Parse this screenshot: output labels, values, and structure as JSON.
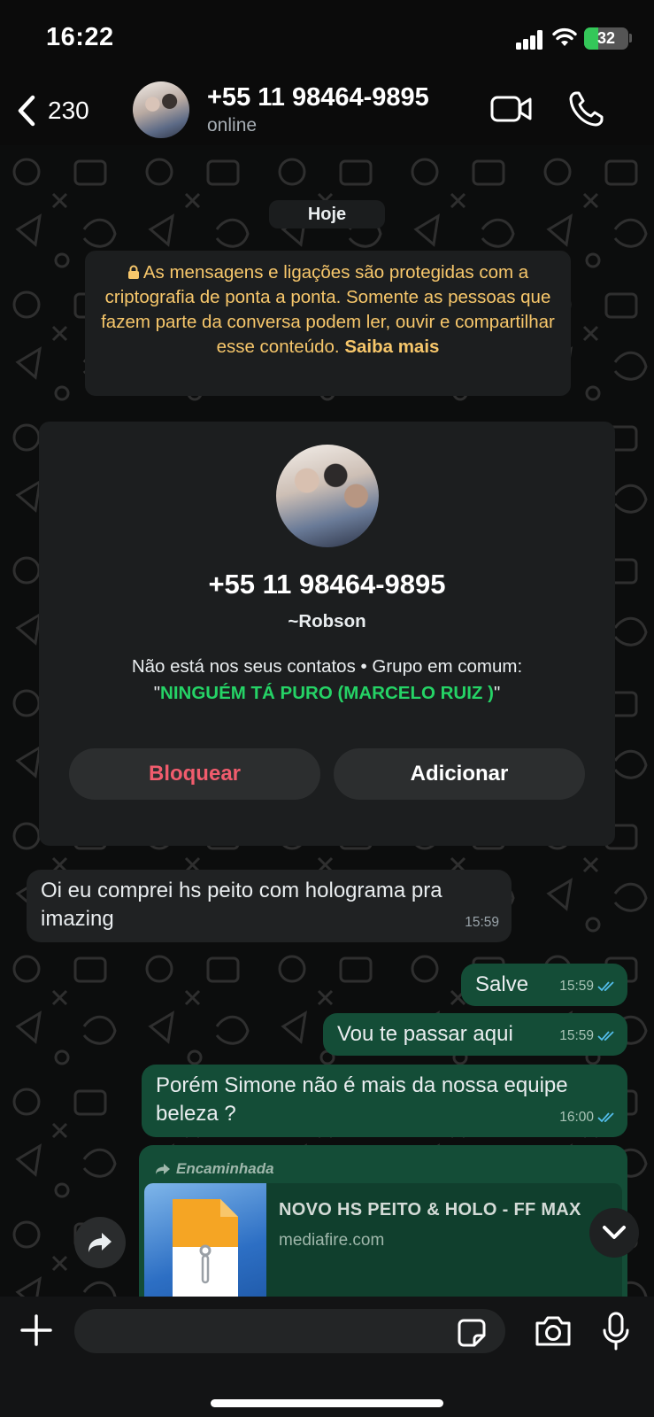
{
  "status_bar": {
    "time": "16:22",
    "battery": "32",
    "battery_level": 0.32
  },
  "header": {
    "back_count": "230",
    "contact_name": "+55 11 98464-9895",
    "contact_status": "online"
  },
  "chat": {
    "date_label": "Hoje",
    "encryption_notice": "As mensagens e ligações são protegidas com a criptografia de ponta a ponta. Somente as pessoas que fazem parte da conversa podem ler, ouvir e compartilhar esse conteúdo.",
    "encryption_link": "Saiba mais",
    "contact_card": {
      "phone": "+55 11 98464-9895",
      "push_name": "~Robson",
      "info_prefix": "Não está nos seus contatos • Grupo em comum:",
      "group_name": "NINGUÉM TÁ PURO (MARCELO RUIZ )",
      "block_label": "Bloquear",
      "add_label": "Adicionar"
    },
    "messages": [
      {
        "direction": "in",
        "text": "Oi eu comprei hs peito com holograma pra imazing",
        "time": "15:59"
      },
      {
        "direction": "out",
        "text": "Salve",
        "time": "15:59",
        "read": true
      },
      {
        "direction": "out",
        "text": "Vou te passar aqui",
        "time": "15:59",
        "read": true
      },
      {
        "direction": "out",
        "text": "Porém Simone não é mais da nossa equipe beleza ?",
        "time": "16:00",
        "read": true
      }
    ],
    "forwarded": {
      "label": "Encaminhada",
      "link_title": "NOVO HS PEITO & HOLO - FF MAX",
      "link_domain": "mediafire.com"
    }
  },
  "input_bar": {
    "placeholder": ""
  },
  "colors": {
    "accent_green": "#25d366",
    "outgoing_bubble": "#144d37",
    "incoming_bubble": "#202223",
    "notice_text": "#f7c76b",
    "block_red": "#f15c6d",
    "read_ticks": "#53bdeb"
  }
}
